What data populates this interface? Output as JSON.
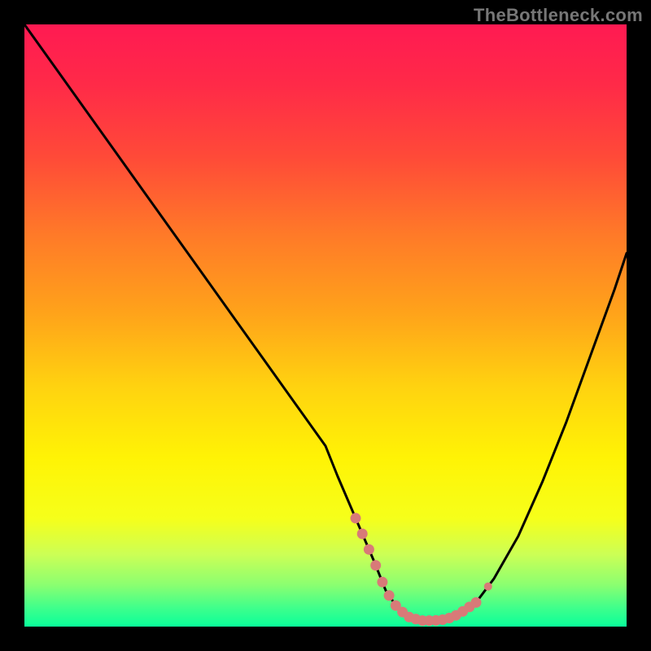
{
  "watermark": "TheBottleneck.com",
  "colors": {
    "frame": "#000000",
    "curve": "#000000",
    "marker": "#d87a78",
    "gradient_stops": [
      {
        "offset": 0.0,
        "color": "#ff1a52"
      },
      {
        "offset": 0.1,
        "color": "#ff2a48"
      },
      {
        "offset": 0.22,
        "color": "#ff4a38"
      },
      {
        "offset": 0.35,
        "color": "#ff7a28"
      },
      {
        "offset": 0.48,
        "color": "#ffa31a"
      },
      {
        "offset": 0.6,
        "color": "#ffd210"
      },
      {
        "offset": 0.72,
        "color": "#fff305"
      },
      {
        "offset": 0.82,
        "color": "#f6ff1a"
      },
      {
        "offset": 0.88,
        "color": "#ccff55"
      },
      {
        "offset": 0.93,
        "color": "#8cff70"
      },
      {
        "offset": 0.97,
        "color": "#3dff8c"
      },
      {
        "offset": 1.0,
        "color": "#0aff9a"
      }
    ]
  },
  "chart_data": {
    "type": "line",
    "title": "",
    "xlabel": "",
    "ylabel": "",
    "xlim": [
      0,
      100
    ],
    "ylim": [
      0,
      100
    ],
    "grid": false,
    "series": [
      {
        "name": "bottleneck-curve",
        "x": [
          0,
          5,
          10,
          15,
          20,
          25,
          30,
          35,
          40,
          45,
          50,
          52,
          55,
          58,
          60,
          62,
          64,
          66,
          68,
          70,
          72,
          75,
          78,
          82,
          86,
          90,
          94,
          98,
          100
        ],
        "values": [
          100,
          93,
          86,
          79,
          72,
          65,
          58,
          51,
          44,
          37,
          30,
          25,
          18,
          11,
          6,
          3,
          1.5,
          1,
          1,
          1.2,
          2,
          4,
          8,
          15,
          24,
          34,
          45,
          56,
          62
        ]
      }
    ],
    "markers": [
      {
        "name": "optimal-range",
        "x_start": 55,
        "x_end": 75,
        "y": 2
      }
    ],
    "annotations": []
  }
}
